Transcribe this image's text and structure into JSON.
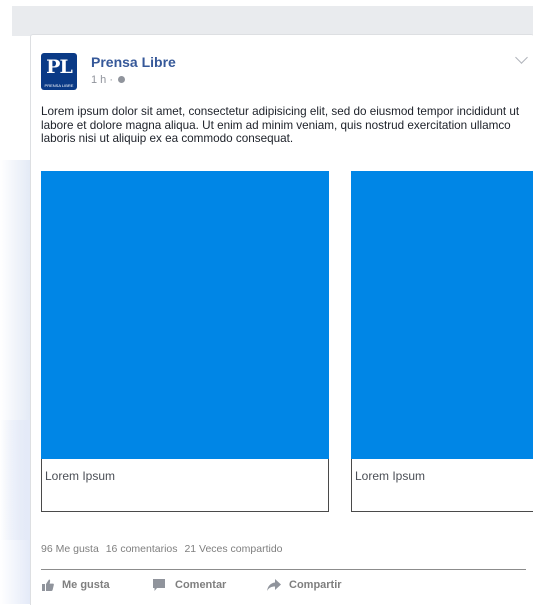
{
  "post": {
    "page_name": "Prensa Libre",
    "avatar_text": "PL",
    "avatar_subtext": "PRENSA LIBRE",
    "time": "1 h",
    "separator": "·",
    "body": "Lorem ipsum dolor sit amet, consectetur adipisicing elit, sed do eiusmod tempor incididunt ut labore et dolore magna aliqua. Ut enim ad minim veniam, quis nostrud exercitation ullamco laboris nisi ut aliquip ex ea commodo consequat."
  },
  "carousel": {
    "items": [
      {
        "caption": "Lorem Ipsum",
        "color": "#0086e6"
      },
      {
        "caption": "Lorem Ipsum",
        "color": "#0086e6"
      }
    ]
  },
  "stats": {
    "likes": "96 Me gusta",
    "comments": "16 comentarios",
    "shares": "21 Veces compartido"
  },
  "actions": {
    "like_label": "Me gusta",
    "comment_label": "Comentar",
    "share_label": "Compartir"
  },
  "colors": {
    "accent": "#365899",
    "image_blue": "#0086e6",
    "avatar_blue": "#0a3a86"
  },
  "icons": {
    "avatar": "prensa-libre-logo",
    "audience": "globe-icon",
    "menu": "chevron-down-icon",
    "like": "thumbs-up-icon",
    "comment": "comment-icon",
    "share": "share-arrow-icon"
  }
}
